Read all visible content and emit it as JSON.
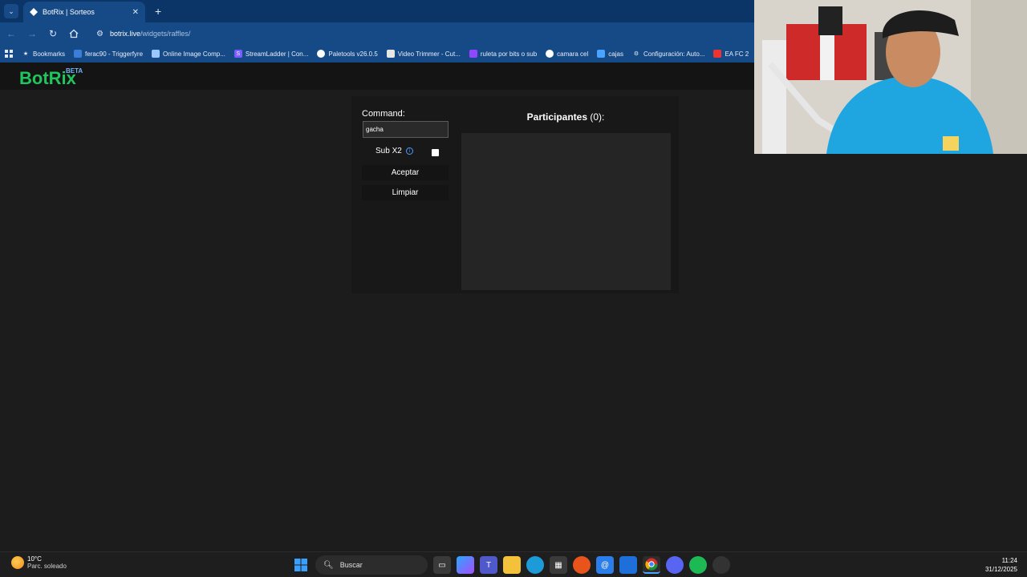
{
  "browser": {
    "tab_title": "BotRix | Sorteos",
    "url_host": "botrix.live",
    "url_path": "/widgets/raffles/"
  },
  "bookmarks": [
    {
      "label": "Bookmarks",
      "icon": "star-icon",
      "color": "#ffffff"
    },
    {
      "label": "ferac90 - Triggerfyre",
      "icon": "triggerfyre-icon",
      "color": "#3b7dd8"
    },
    {
      "label": "Online Image Comp...",
      "icon": "cloud-icon",
      "color": "#9bc7ff"
    },
    {
      "label": "StreamLadder | Con...",
      "icon": "streamladder-icon",
      "color": "#7a5cff"
    },
    {
      "label": "Paletools v26.0.5",
      "icon": "globe-icon",
      "color": "#ffffff"
    },
    {
      "label": "Video Trimmer - Cut...",
      "icon": "video-icon",
      "color": "#e6e6e6"
    },
    {
      "label": "ruleta por bits o sub",
      "icon": "twitch-icon",
      "color": "#9146ff"
    },
    {
      "label": "camara cel",
      "icon": "camera-icon",
      "color": "#ffffff"
    },
    {
      "label": "cajas",
      "icon": "box-icon",
      "color": "#4aa3ff"
    },
    {
      "label": "Configuración: Auto...",
      "icon": "gear-icon",
      "color": "#ffffff"
    },
    {
      "label": "EA FC 2",
      "icon": "ea-icon",
      "color": "#e33"
    }
  ],
  "app": {
    "logo": "BotRix",
    "badge": "BETA"
  },
  "raffle": {
    "command_label": "Command:",
    "command_value": "gacha",
    "sub_label": "Sub X2",
    "sub_checked": false,
    "accept_label": "Aceptar",
    "clear_label": "Limpiar",
    "participants_title": "Participantes",
    "participants_count": "(0):"
  },
  "taskbar": {
    "temperature": "10°C",
    "condition": "Parc. soleado",
    "search_label": "Buscar",
    "time": "11:24",
    "date": "31/12/2025"
  }
}
